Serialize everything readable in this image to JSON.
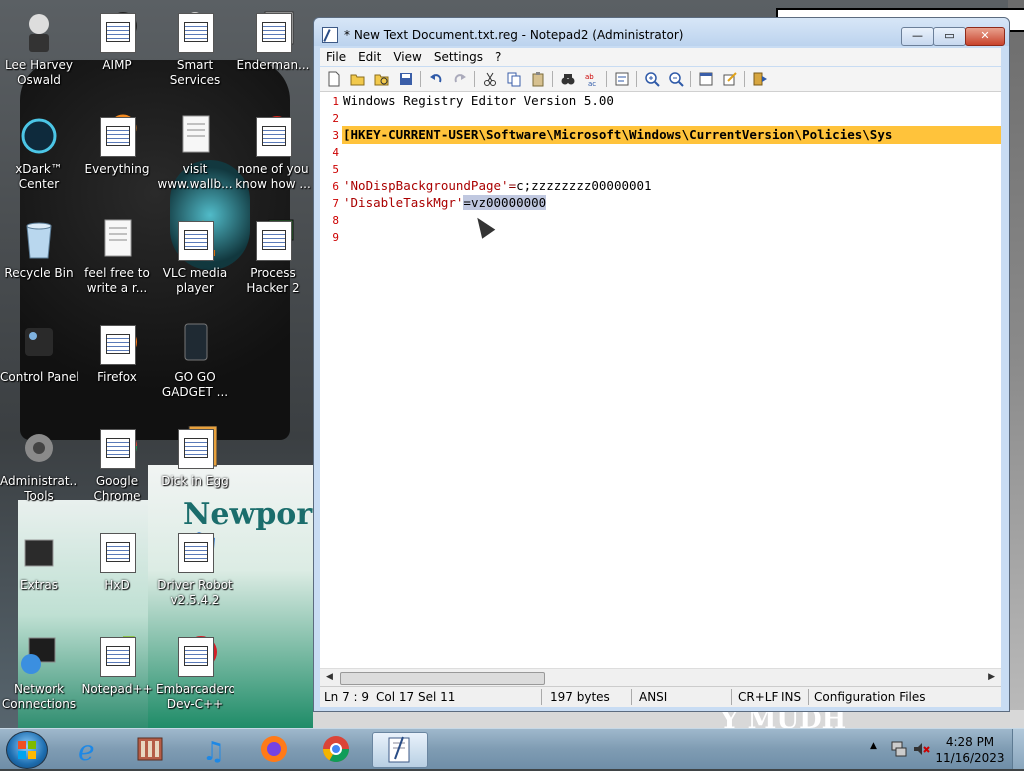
{
  "desktop": {
    "newport_text": "Newport",
    "bottom_text": "Y MUDH",
    "icons": [
      {
        "label1": "Lee Harvey",
        "label2": "Oswald"
      },
      {
        "label1": "AIMP",
        "label2": ""
      },
      {
        "label1": "Smart",
        "label2": "Services"
      },
      {
        "label1": "Enderman...",
        "label2": ""
      },
      {
        "label1": "xDark™",
        "label2": "Center"
      },
      {
        "label1": "Everything",
        "label2": ""
      },
      {
        "label1": "visit",
        "label2": "www.wallb..."
      },
      {
        "label1": "none of you",
        "label2": "know how ..."
      },
      {
        "label1": "Recycle Bin",
        "label2": ""
      },
      {
        "label1": "feel free to",
        "label2": "write a r..."
      },
      {
        "label1": "VLC media",
        "label2": "player"
      },
      {
        "label1": "Process",
        "label2": "Hacker 2"
      },
      {
        "label1": "Control Panel",
        "label2": ""
      },
      {
        "label1": "Firefox",
        "label2": ""
      },
      {
        "label1": "GO GO",
        "label2": "GADGET ..."
      },
      {
        "label1": "Administrat...",
        "label2": "Tools"
      },
      {
        "label1": "Google",
        "label2": "Chrome"
      },
      {
        "label1": "Dick in Egg",
        "label2": ""
      },
      {
        "label1": "Extras",
        "label2": ""
      },
      {
        "label1": "HxD",
        "label2": ""
      },
      {
        "label1": "Driver Robot",
        "label2": "v2.5.4.2"
      },
      {
        "label1": "Network",
        "label2": "Connections"
      },
      {
        "label1": "Notepad++",
        "label2": ""
      },
      {
        "label1": "Embarcadero",
        "label2": "Dev-C++"
      }
    ]
  },
  "window": {
    "title": "* New Text Document.txt.reg - Notepad2 (Administrator)",
    "minimize": "—",
    "maximize": "▭",
    "close": "✕",
    "menu": [
      "File",
      "Edit",
      "View",
      "Settings",
      "?"
    ]
  },
  "editor": {
    "line_numbers": [
      "1",
      "2",
      "3",
      "4",
      "5",
      "6",
      "7",
      "8",
      "9"
    ],
    "line1": "Windows Registry Editor Version 5.00",
    "line3": "[HKEY-CURRENT-USER\\Software\\Microsoft\\Windows\\CurrentVersion\\Policies\\Sys",
    "line6_key": "'NoDispBackgroundPage'",
    "line6_eq": "=",
    "line6_val": "c;zzzzzzzz00000001",
    "line7_key": "'DisableTaskMgr'",
    "line7_sel": "=vz00000000"
  },
  "status": {
    "position": "Ln 7 : 9",
    "col": "Col 17",
    "sel": "Sel 11",
    "size": "197 bytes",
    "encoding": "ANSI",
    "eol": "CR+LF",
    "ovr": "INS",
    "scheme": "Configuration Files"
  },
  "taskbar": {
    "time": "4:28 PM",
    "date": "11/16/2023",
    "tray_arrow": "▲"
  }
}
